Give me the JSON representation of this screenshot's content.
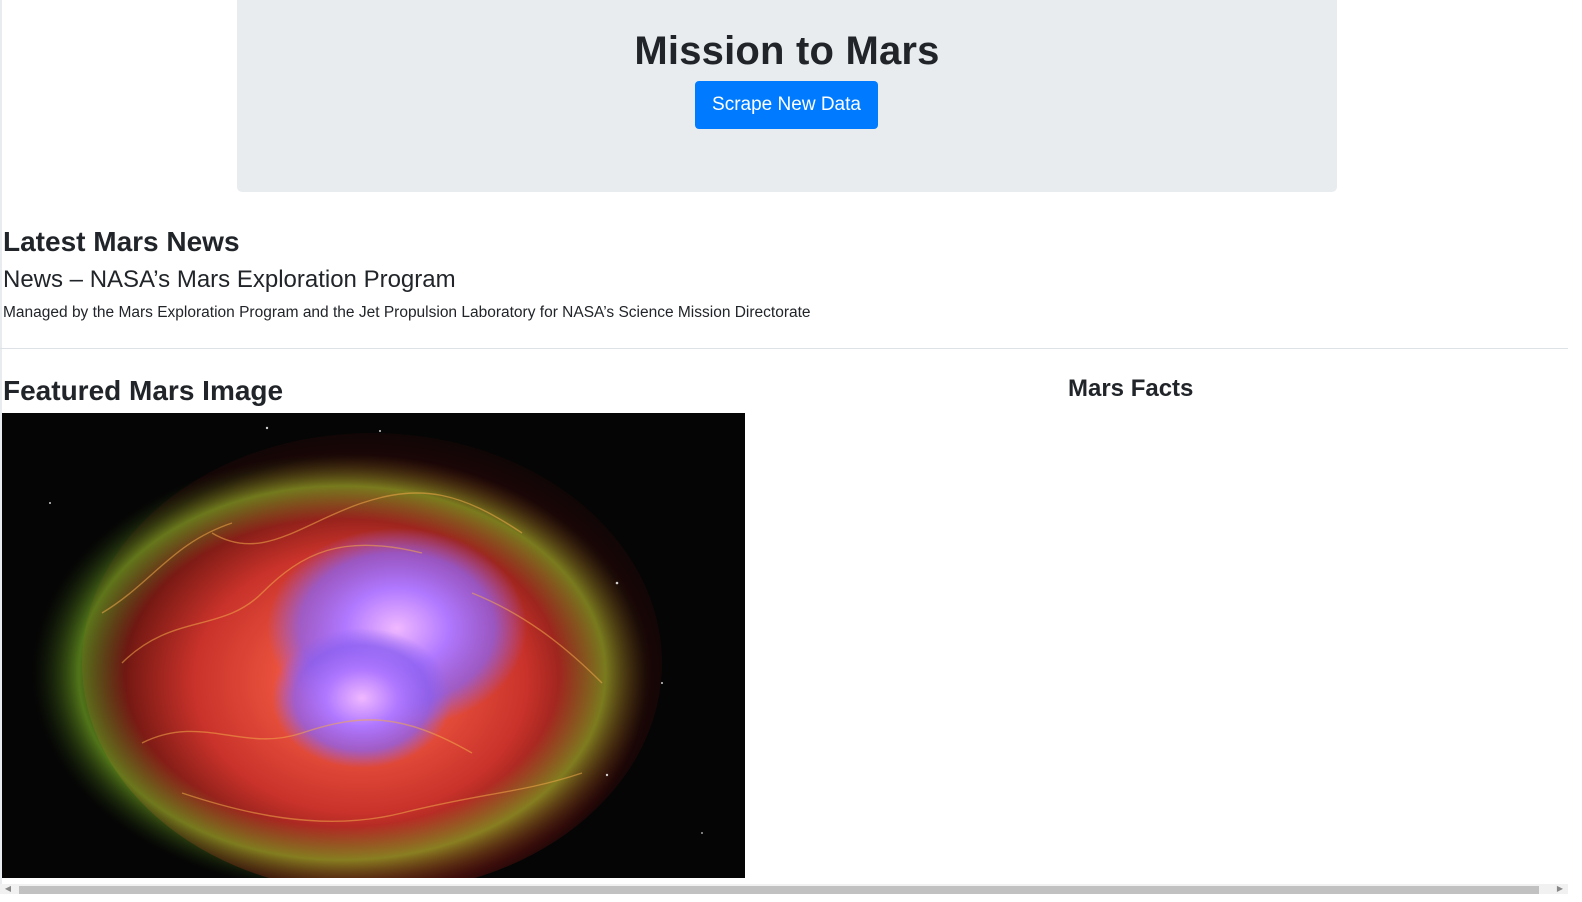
{
  "jumbotron": {
    "title": "Mission to Mars",
    "scrape_button_label": "Scrape New Data"
  },
  "news": {
    "heading": "Latest Mars News",
    "title": "News – NASA’s Mars Exploration Program",
    "teaser": "Managed by the Mars Exploration Program and the Jet Propulsion Laboratory for NASA’s Science Mission Directorate"
  },
  "featured": {
    "heading": "Featured Mars Image"
  },
  "facts": {
    "heading": "Mars Facts"
  },
  "scrollbar": {
    "left_arrow_icon": "chevron-left-icon",
    "right_arrow_icon": "chevron-right-icon"
  },
  "colors": {
    "primary_button": "#007bff",
    "jumbotron_bg": "#e9ecef",
    "text": "#212529"
  }
}
